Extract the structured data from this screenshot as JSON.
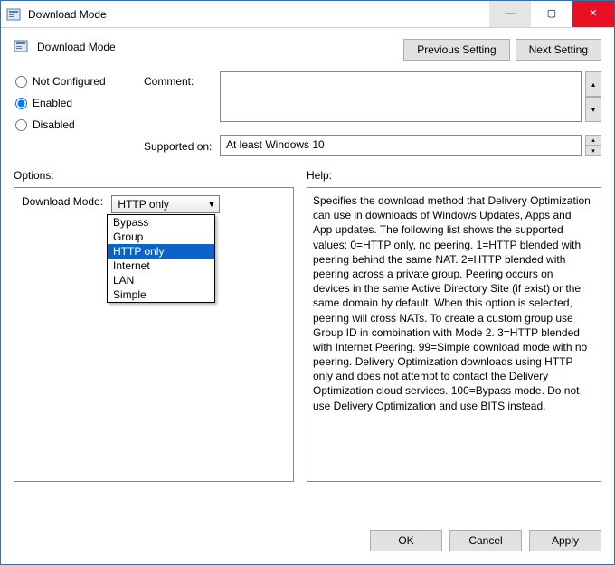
{
  "title": "Download Mode",
  "header_title": "Download Mode",
  "nav": {
    "prev": "Previous Setting",
    "next": "Next Setting"
  },
  "state": {
    "not_configured": "Not Configured",
    "enabled": "Enabled",
    "disabled": "Disabled",
    "selected": "enabled"
  },
  "labels": {
    "comment": "Comment:",
    "supported": "Supported on:",
    "options": "Options:",
    "help": "Help:",
    "download_mode": "Download Mode:"
  },
  "supported_text": "At least Windows 10",
  "download_mode": {
    "selected": "HTTP only",
    "options": [
      "Bypass",
      "Group",
      "HTTP only",
      "Internet",
      "LAN",
      "Simple"
    ]
  },
  "help_text": "Specifies the download method that Delivery Optimization can use in downloads of Windows Updates, Apps and App updates. The following list shows the supported values: 0=HTTP only, no peering. 1=HTTP blended with peering behind the same NAT. 2=HTTP blended with peering across a private group. Peering occurs on devices in the same Active Directory Site (if exist) or the same domain by default. When this option is selected, peering will cross NATs. To create a custom group use Group ID in combination with Mode 2. 3=HTTP blended with Internet Peering. 99=Simple download mode with no peering. Delivery Optimization downloads using HTTP only and does not attempt to contact the Delivery Optimization cloud services. 100=Bypass mode. Do not use Delivery Optimization and use BITS instead.",
  "footer": {
    "ok": "OK",
    "cancel": "Cancel",
    "apply": "Apply"
  }
}
